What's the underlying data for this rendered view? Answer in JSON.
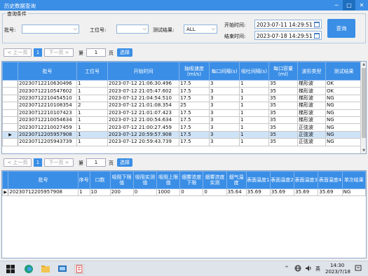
{
  "window": {
    "title": "历史数据查询",
    "min": "─",
    "max": "□",
    "close": "✕"
  },
  "query": {
    "group_title": "查询条件",
    "batch_label": "批号:",
    "batch_value": "",
    "station_label": "工位号:",
    "station_value": "",
    "result_label": "测试结果:",
    "result_value": "ALL",
    "start_label": "开始时间:",
    "start_value": "2023-07-11 14:29:51",
    "end_label": "结束时间:",
    "end_value": "2023-07-18 14:29:51",
    "query_button": "查询"
  },
  "pager_top": {
    "prev": "< 上一页",
    "page": "1",
    "next": "下一页 >",
    "goto_pre": "第",
    "goto_value": "1",
    "goto_post": "页",
    "select": "选择"
  },
  "pager_bottom": {
    "prev": "< 上一页",
    "page": "1",
    "next": "下一页 >",
    "goto_pre": "第",
    "goto_value": "1",
    "goto_post": "页",
    "select": "选择"
  },
  "grid1": {
    "headers": [
      "批号",
      "工位号",
      "开始时间",
      "抽吸速度(ml/s)",
      "每口间隔(s)",
      "吸吐间隔(s)",
      "每口容量(ml)",
      "波形类型",
      "测试结果"
    ],
    "rows": [
      [
        "20230712210630496",
        "1",
        "2023-07-12 21:06:30.496",
        "17.5",
        "3",
        "1",
        "35",
        "梯形波",
        "OK"
      ],
      [
        "20230712210547602",
        "1",
        "2023-07-12 21:05:47.602",
        "17.5",
        "3",
        "1",
        "35",
        "梯形波",
        "OK"
      ],
      [
        "20230712210454510",
        "1",
        "2023-07-12 21:04:54.510",
        "17.5",
        "3",
        "1",
        "35",
        "梯形波",
        "NG"
      ],
      [
        "20230712210108354",
        "2",
        "2023-07-12 21:01:08.354",
        "25",
        "3",
        "1",
        "35",
        "梯形波",
        "NG"
      ],
      [
        "20230712210107423",
        "1",
        "2023-07-12 21:01:07.423",
        "17.5",
        "3",
        "1",
        "35",
        "梯形波",
        "NG"
      ],
      [
        "20230712210054634",
        "1",
        "2023-07-12 21:00:54.634",
        "17.5",
        "3",
        "1",
        "35",
        "梯形波",
        "NG"
      ],
      [
        "20230712210027459",
        "1",
        "2023-07-12 21:00:27.459",
        "17.5",
        "3",
        "1",
        "35",
        "正弦波",
        "NG"
      ],
      [
        "20230712205957908",
        "1",
        "2023-07-12 20:59:57.908",
        "17.5",
        "3",
        "1",
        "35",
        "正弦波",
        "NG"
      ],
      [
        "20230712205943739",
        "1",
        "2023-07-12 20:59:43.739",
        "17.5",
        "3",
        "1",
        "35",
        "正弦波",
        "NG"
      ]
    ],
    "selected_index": 7,
    "row_marker": "▶"
  },
  "grid2": {
    "headers": [
      "批号",
      "序号",
      "口数",
      "吸阻下限值",
      "吸阻实测值",
      "吸阻上限值",
      "烟雾浓度下限",
      "烟雾浓度实测",
      "烟气温度",
      "表面温度1",
      "表面温度2",
      "表面温度3",
      "表面温度4",
      "单次结果"
    ],
    "rows": [
      [
        "20230712205957908",
        "1",
        "10",
        "200",
        "0",
        "1000",
        "0",
        "0",
        "35.64",
        "35.69",
        "35.69",
        "35.69",
        "35.69",
        "NG"
      ]
    ],
    "row_marker": "▶"
  },
  "taskbar": {
    "tray_chevron": "^",
    "tray_ime": "英",
    "time": "14:30",
    "date": "2023/7/18"
  }
}
